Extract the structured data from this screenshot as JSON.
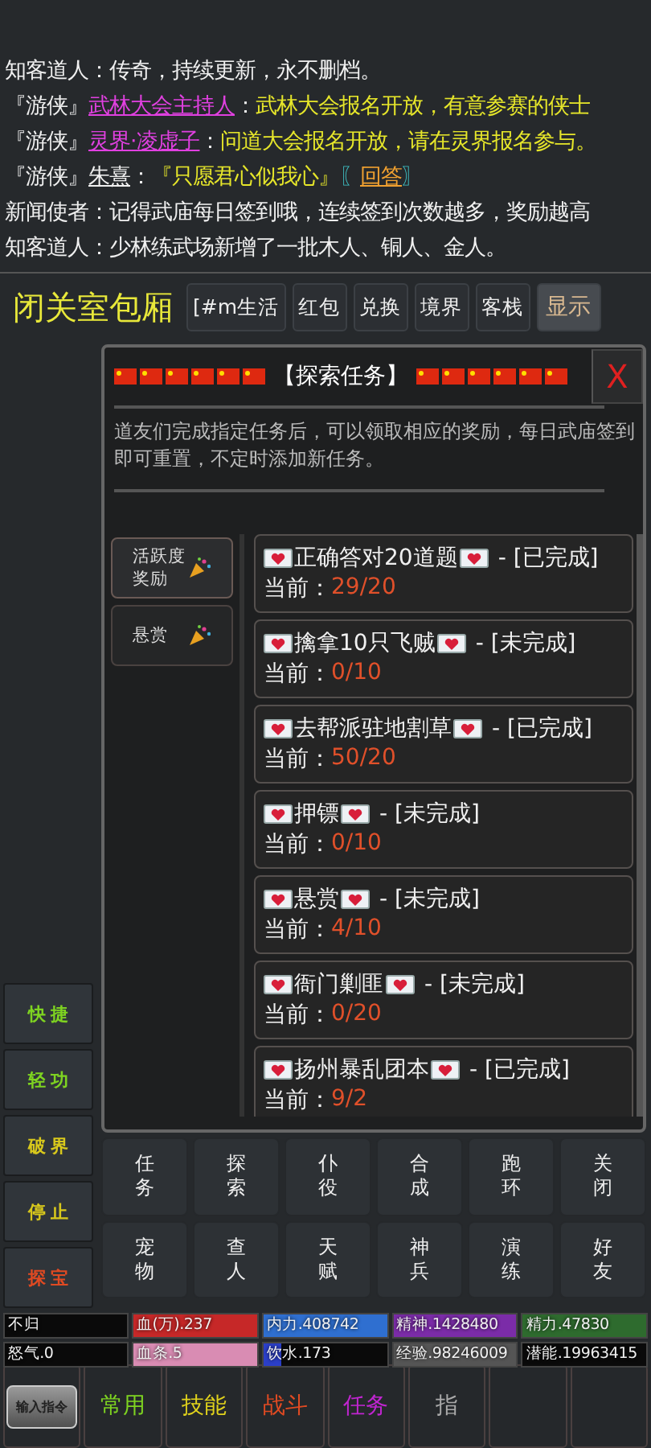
{
  "chat": [
    {
      "segments": [
        {
          "kind": "plain",
          "text": "知客道人：传奇，持续更新，永不删档。"
        }
      ]
    },
    {
      "segments": [
        {
          "kind": "plain",
          "text": "『游侠』"
        },
        {
          "kind": "name",
          "text": "武林大会主持人"
        },
        {
          "kind": "plain",
          "text": "："
        },
        {
          "kind": "message",
          "text": "武林大会报名开放，有意参赛的侠士"
        }
      ]
    },
    {
      "segments": [
        {
          "kind": "plain",
          "text": "『游侠』"
        },
        {
          "kind": "name",
          "text": "灵界·凌虚子"
        },
        {
          "kind": "plain",
          "text": "："
        },
        {
          "kind": "message",
          "text": "问道大会报名开放，请在灵界报名参与。"
        }
      ]
    },
    {
      "segments": [
        {
          "kind": "plain",
          "text": "『游侠』"
        },
        {
          "kind": "user",
          "text": "朱熹"
        },
        {
          "kind": "plain",
          "text": "："
        },
        {
          "kind": "message",
          "text": "『只愿君心似我心』"
        },
        {
          "kind": "bracket",
          "text": "〖"
        },
        {
          "kind": "link",
          "text": "回答"
        },
        {
          "kind": "bracket",
          "text": "〗"
        }
      ]
    },
    {
      "segments": [
        {
          "kind": "plain",
          "text": "新闻使者：记得武庙每日签到哦，连续签到次数越多，奖励越高"
        }
      ]
    },
    {
      "segments": [
        {
          "kind": "plain",
          "text": "知客道人：少林练武场新增了一批木人、铜人、金人。"
        }
      ]
    }
  ],
  "header": {
    "title": "闭关室包厢",
    "buttons": [
      {
        "label": "[#m生活",
        "selected": false
      },
      {
        "label": "红包",
        "selected": false
      },
      {
        "label": "兑换",
        "selected": false
      },
      {
        "label": "境界",
        "selected": false
      },
      {
        "label": "客栈",
        "selected": false
      },
      {
        "label": "显示",
        "selected": true
      }
    ]
  },
  "dialog": {
    "title": "【探索任务】",
    "close": "X",
    "description": "道友们完成指定任务后，可以领取相应的奖励，每日武庙签到即可重置，不定时添加新任务。",
    "tabs": [
      {
        "label": "活跃度奖励",
        "selected": true
      },
      {
        "label": "悬赏",
        "selected": false
      }
    ],
    "tasks": [
      {
        "title": "正确答对20道题",
        "status": "- [已完成]",
        "progress_label": "当前：",
        "progress": "29/20"
      },
      {
        "title": "擒拿10只飞贼",
        "status": "- [未完成]",
        "progress_label": "当前：",
        "progress": "0/10"
      },
      {
        "title": "去帮派驻地割草",
        "status": "- [已完成]",
        "progress_label": "当前：",
        "progress": "50/20"
      },
      {
        "title": "押镖",
        "status": "- [未完成]",
        "progress_label": "当前：",
        "progress": "0/10"
      },
      {
        "title": "悬赏",
        "status": "- [未完成]",
        "progress_label": "当前：",
        "progress": "4/10"
      },
      {
        "title": "衙门剿匪",
        "status": "- [未完成]",
        "progress_label": "当前：",
        "progress": "0/20"
      },
      {
        "title": "扬州暴乱团本",
        "status": "- [已完成]",
        "progress_label": "当前：",
        "progress": "9/2"
      }
    ]
  },
  "side_buttons": [
    {
      "label": "快捷",
      "color": "#7ed321"
    },
    {
      "label": "轻功",
      "color": "#7ed321"
    },
    {
      "label": "破界",
      "color": "#d8c81c"
    },
    {
      "label": "停止",
      "color": "#d8c81c"
    },
    {
      "label": "探宝",
      "color": "#e04a22"
    }
  ],
  "actions": [
    "任务",
    "探索",
    "仆役",
    "合成",
    "跑环",
    "关闭",
    "宠物",
    "查人",
    "天赋",
    "神兵",
    "演练",
    "好友"
  ],
  "stats": [
    {
      "label": "不归"
    },
    {
      "label": "血(万).237",
      "color": "#c62828",
      "level": 1
    },
    {
      "label": "内力.408742",
      "color": "#2f6fd0",
      "level": 1
    },
    {
      "label": "精神.1428480",
      "color": "#7b2ca8",
      "level": 1
    },
    {
      "label": "精力.47830",
      "color": "#2e6b2e",
      "level": 1
    },
    {
      "label": "怒气.0"
    },
    {
      "label": "血条.5",
      "color": "#d98cb3",
      "level": 1
    },
    {
      "label": "饮水.173",
      "color": "#2b3fc8",
      "level": 0.15
    },
    {
      "label": "经验.98246009",
      "color": "#555555",
      "level": 1
    },
    {
      "label": "潜能.19963415"
    }
  ],
  "bottom_tabs": [
    {
      "kind": "command",
      "label": "输入指令"
    },
    {
      "kind": "tab",
      "label": "常用",
      "color": "#7ed321"
    },
    {
      "kind": "tab",
      "label": "技能",
      "color": "#e0d21c"
    },
    {
      "kind": "tab",
      "label": "战斗",
      "color": "#e04a22"
    },
    {
      "kind": "tab",
      "label": "任务",
      "color": "#c025d0"
    },
    {
      "kind": "tab",
      "label": "指",
      "color": "#aaaaaa"
    }
  ]
}
